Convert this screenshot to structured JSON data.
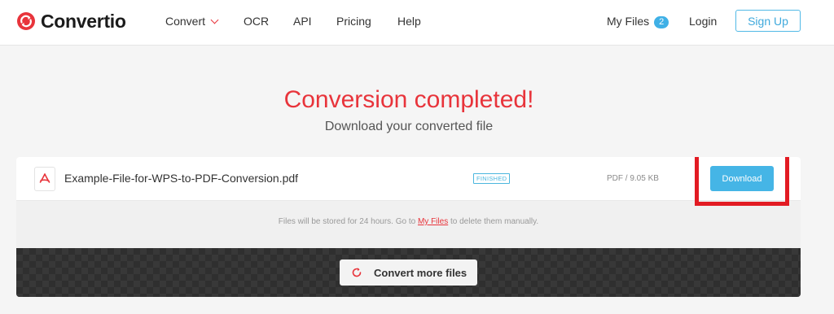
{
  "brand": {
    "name": "Convertio",
    "color": "#e8343b"
  },
  "nav": {
    "convert": "Convert",
    "ocr": "OCR",
    "api": "API",
    "pricing": "Pricing",
    "help": "Help",
    "my_files": "My Files",
    "my_files_count": "2",
    "login": "Login",
    "signup": "Sign Up"
  },
  "hero": {
    "title": "Conversion completed!",
    "subtitle": "Download your converted file"
  },
  "file": {
    "name": "Example-File-for-WPS-to-PDF-Conversion.pdf",
    "status": "FINISHED",
    "size": "PDF / 9.05 KB",
    "download_label": "Download",
    "icon": "pdf-icon"
  },
  "notice": {
    "before": "Files will be stored for 24 hours. Go to ",
    "link": "My Files",
    "after": " to delete them manually."
  },
  "convert_more": {
    "label": "Convert more files",
    "icon": "refresh-icon"
  },
  "colors": {
    "accent": "#45b5e6",
    "highlight": "#e21b23"
  }
}
